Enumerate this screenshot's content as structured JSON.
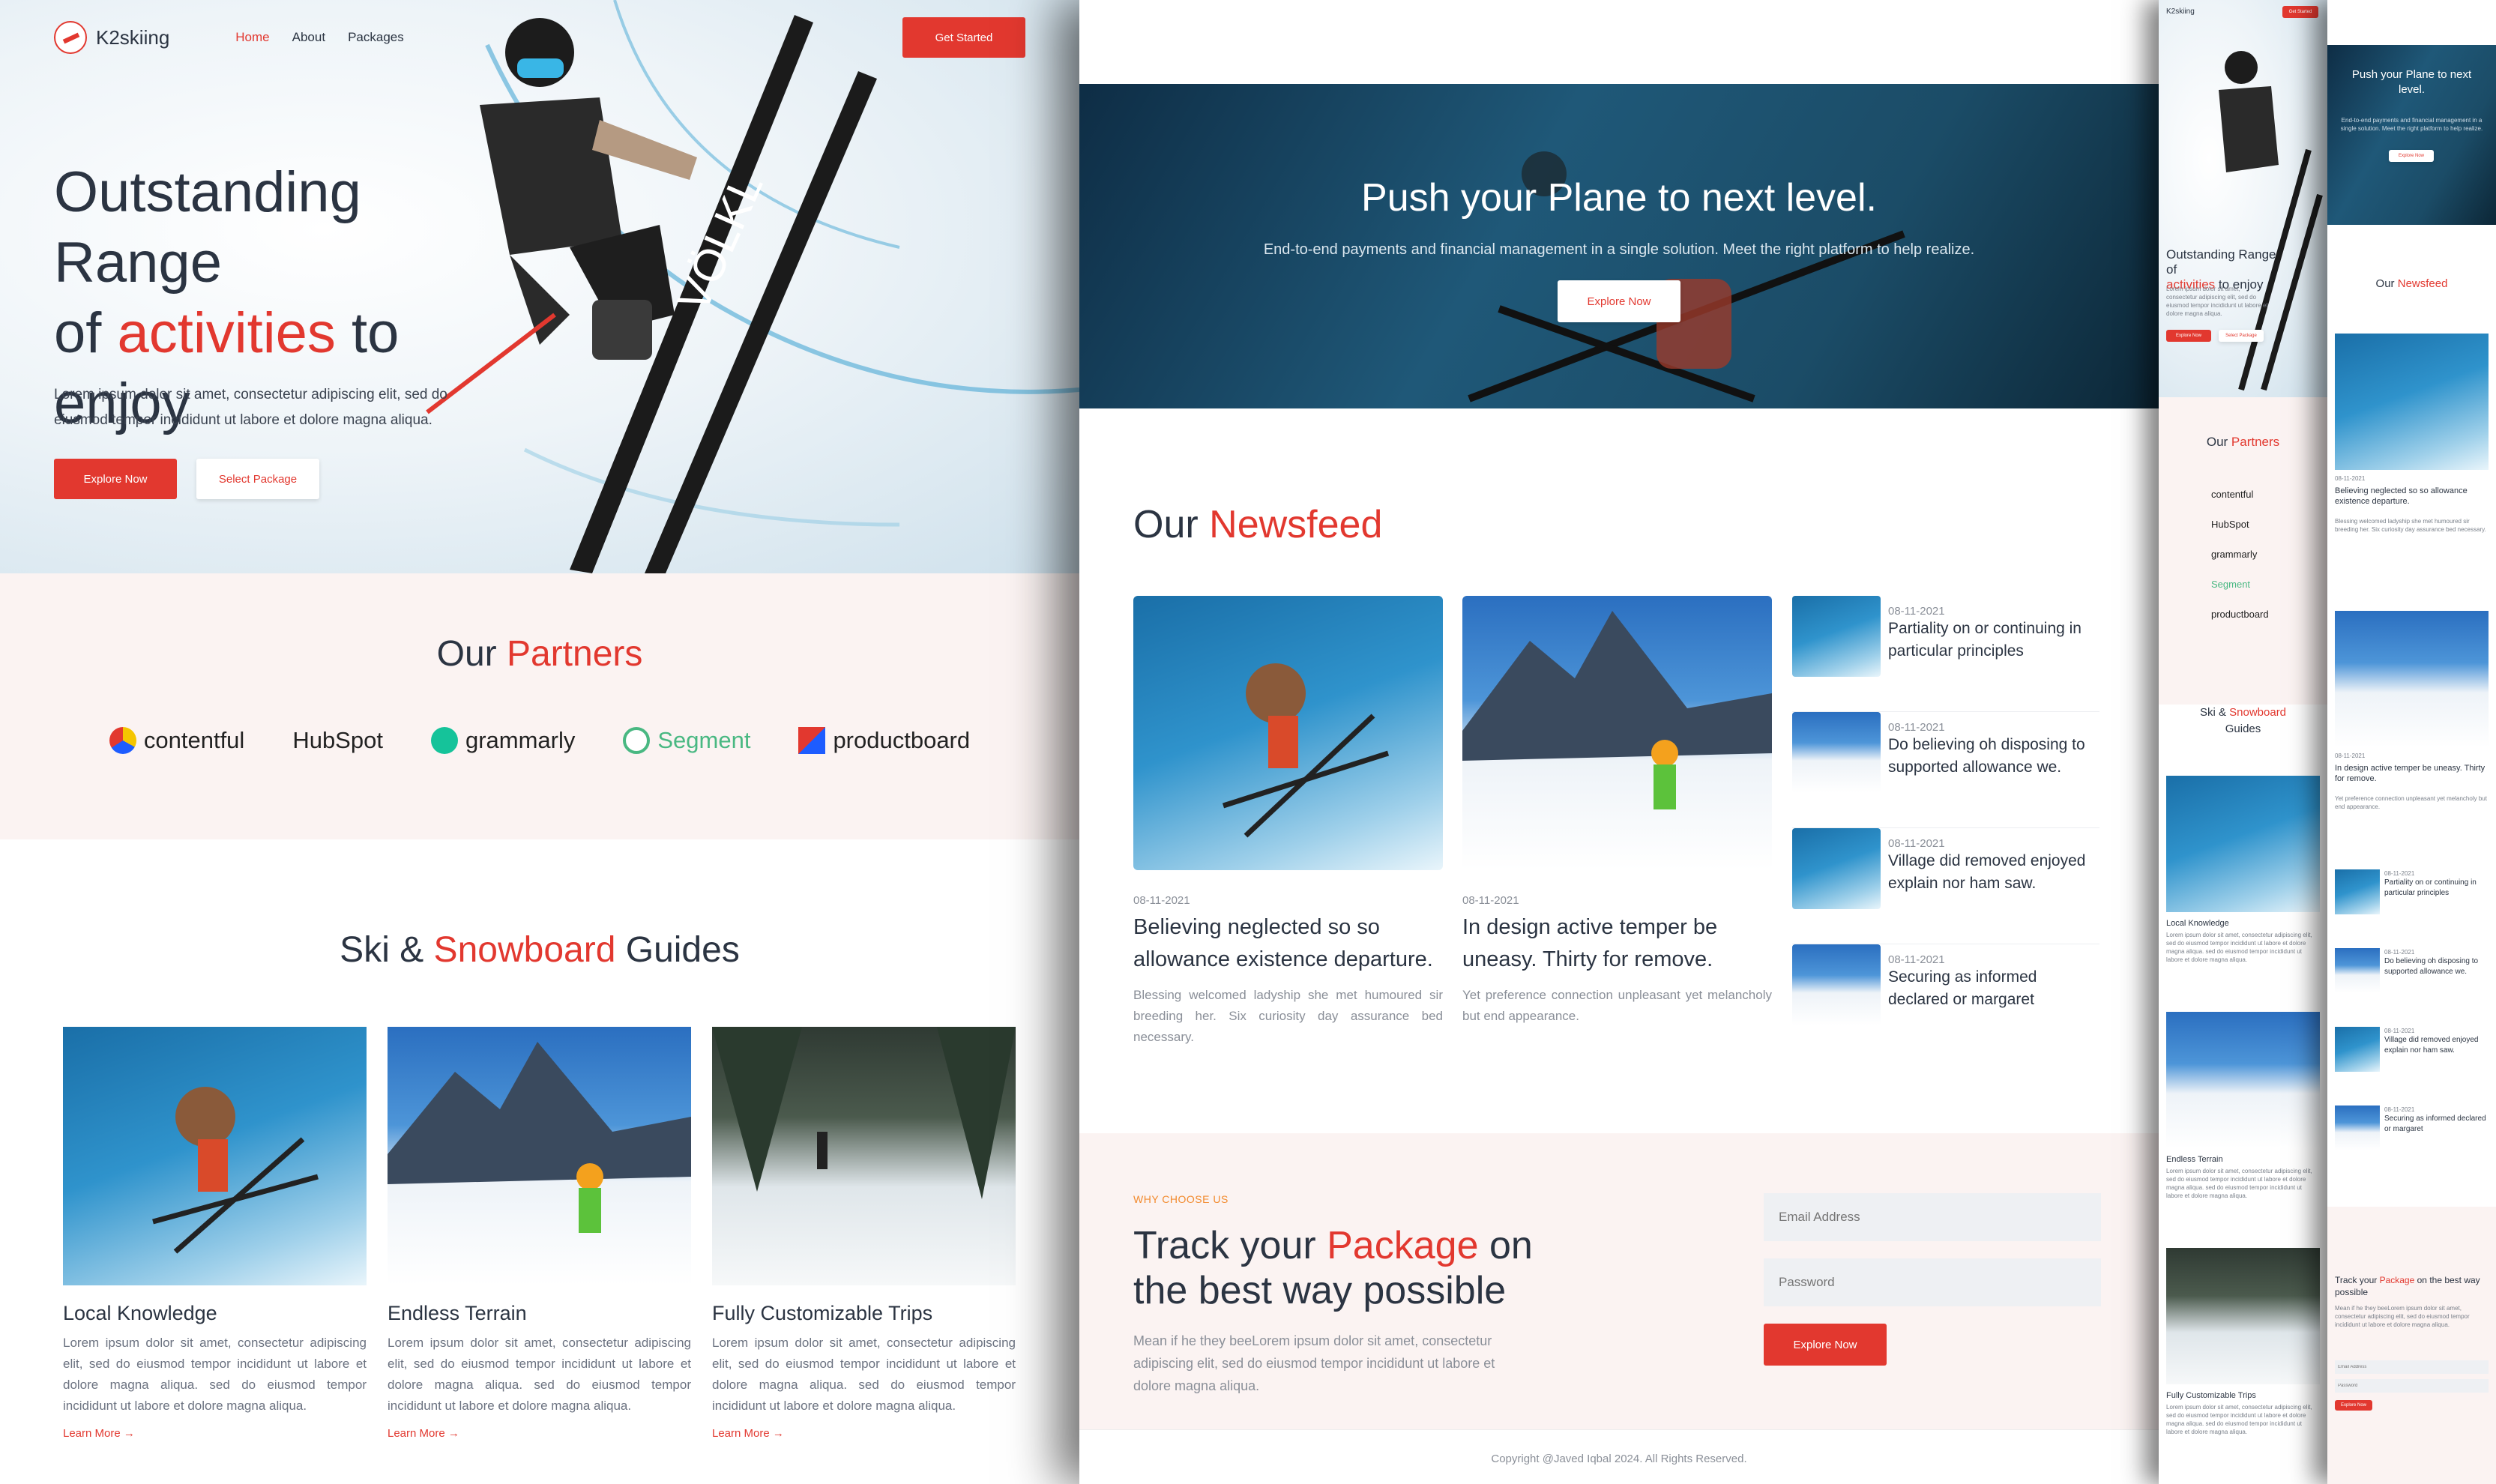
{
  "brand": {
    "name": "K2skiing",
    "accent": "#e2382f"
  },
  "nav": {
    "items": [
      "Home",
      "About",
      "Packages"
    ],
    "cta": "Get Started"
  },
  "hero": {
    "line1": "Outstanding Range",
    "line2_pre": "of ",
    "line2_accent": "activities",
    "line2_post": " to",
    "line3": "enjoy",
    "text": "Lorem ipsum dolor sit amet, consectetur adipiscing elit, sed do eiusmod tempor incididunt ut labore et dolore magna aliqua.",
    "btn_primary": "Explore Now",
    "btn_secondary": "Select Package"
  },
  "partners": {
    "title_pre": "Our ",
    "title_accent": "Partners",
    "logos": [
      "contentful",
      "HubSpot",
      "grammarly",
      "Segment",
      "productboard"
    ]
  },
  "guides": {
    "title_pre": "Ski & ",
    "title_accent": "Snowboard",
    "title_post": " Guides",
    "cards": [
      {
        "title": "Local Knowledge",
        "text": "Lorem ipsum dolor sit amet, consectetur adipiscing elit, sed do eiusmod tempor incididunt ut labore et dolore magna aliqua. sed do eiusmod tempor incididunt ut labore et dolore magna aliqua.",
        "more": "Learn More →"
      },
      {
        "title": "Endless Terrain",
        "text": "Lorem ipsum dolor sit amet, consectetur adipiscing elit, sed do eiusmod tempor incididunt ut labore et dolore magna aliqua. sed do eiusmod tempor incididunt ut labore et dolore magna aliqua.",
        "more": "Learn More →"
      },
      {
        "title": "Fully Customizable Trips",
        "text": "Lorem ipsum dolor sit amet, consectetur adipiscing elit, sed do eiusmod tempor incididunt ut labore et dolore magna aliqua. sed do eiusmod tempor incididunt ut labore et dolore magna aliqua.",
        "more": "Learn More →"
      }
    ]
  },
  "banner": {
    "title": "Push your Plane to next level.",
    "text": "End-to-end payments and financial management in a single solution. Meet the right platform to help realize.",
    "button": "Explore Now"
  },
  "newsfeed": {
    "title_pre": "Our ",
    "title_accent": "Newsfeed",
    "featured": [
      {
        "date": "08-11-2021",
        "title": "Believing neglected so so allowance existence departure.",
        "text": "Blessing welcomed ladyship she met humoured sir breeding her. Six curiosity day assurance bed necessary."
      },
      {
        "date": "08-11-2021",
        "title": "In design active temper be uneasy. Thirty for remove.",
        "text": "Yet preference connection unpleasant yet melancholy but end appearance."
      }
    ],
    "list": [
      {
        "date": "08-11-2021",
        "title": "Partiality on or continuing in particular principles"
      },
      {
        "date": "08-11-2021",
        "title": "Do believing oh disposing to supported allowance we."
      },
      {
        "date": "08-11-2021",
        "title": "Village did removed enjoyed explain nor ham saw."
      },
      {
        "date": "08-11-2021",
        "title": "Securing as informed declared or margaret"
      }
    ]
  },
  "track": {
    "kicker": "WHY CHOOSE US",
    "line1_pre": "Track your ",
    "line1_accent": "Package",
    "line1_post": " on",
    "line2": "the best way possible",
    "text": "Mean if he they beeLorem ipsum dolor sit amet, consectetur adipiscing elit, sed do eiusmod tempor incididunt ut labore et dolore magna aliqua.",
    "email_placeholder": "Email Address",
    "password_placeholder": "Password",
    "button": "Explore Now"
  },
  "footer": {
    "copyright": "Copyright @Javed Iqbal 2024. All Rights Reserved."
  },
  "mobile": {
    "cta": "Get Started",
    "hero_line1": "Outstanding Range of",
    "hero_line2_accent": "activities",
    "hero_line2_post": " to enjoy",
    "banner_title": "Push your Plane to next level."
  }
}
